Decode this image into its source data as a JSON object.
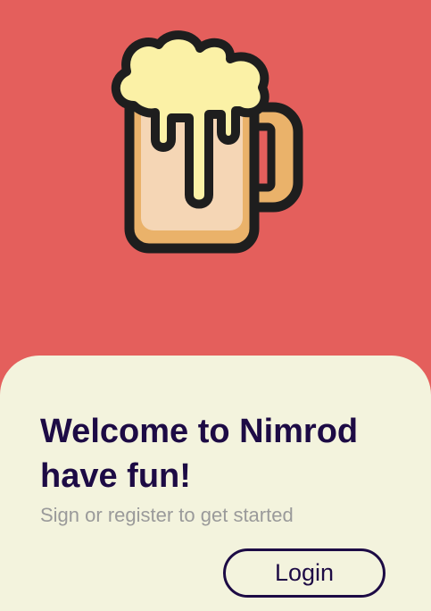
{
  "hero": {
    "icon": "beer-mug-icon"
  },
  "welcome": {
    "title_line1": "Welcome to Nimrod",
    "title_line2": "have fun!",
    "subtitle": "Sign or register to get started"
  },
  "actions": {
    "login_label": "Login"
  },
  "colors": {
    "background": "#e45f5c",
    "sheet": "#f3f3dd",
    "title": "#1d0b45",
    "subtitle": "#9a9a9a",
    "mug_glass": "#f5d6b5",
    "mug_handle": "#eab26a",
    "foam": "#fbf1a6",
    "outline": "#1e1e1e"
  }
}
